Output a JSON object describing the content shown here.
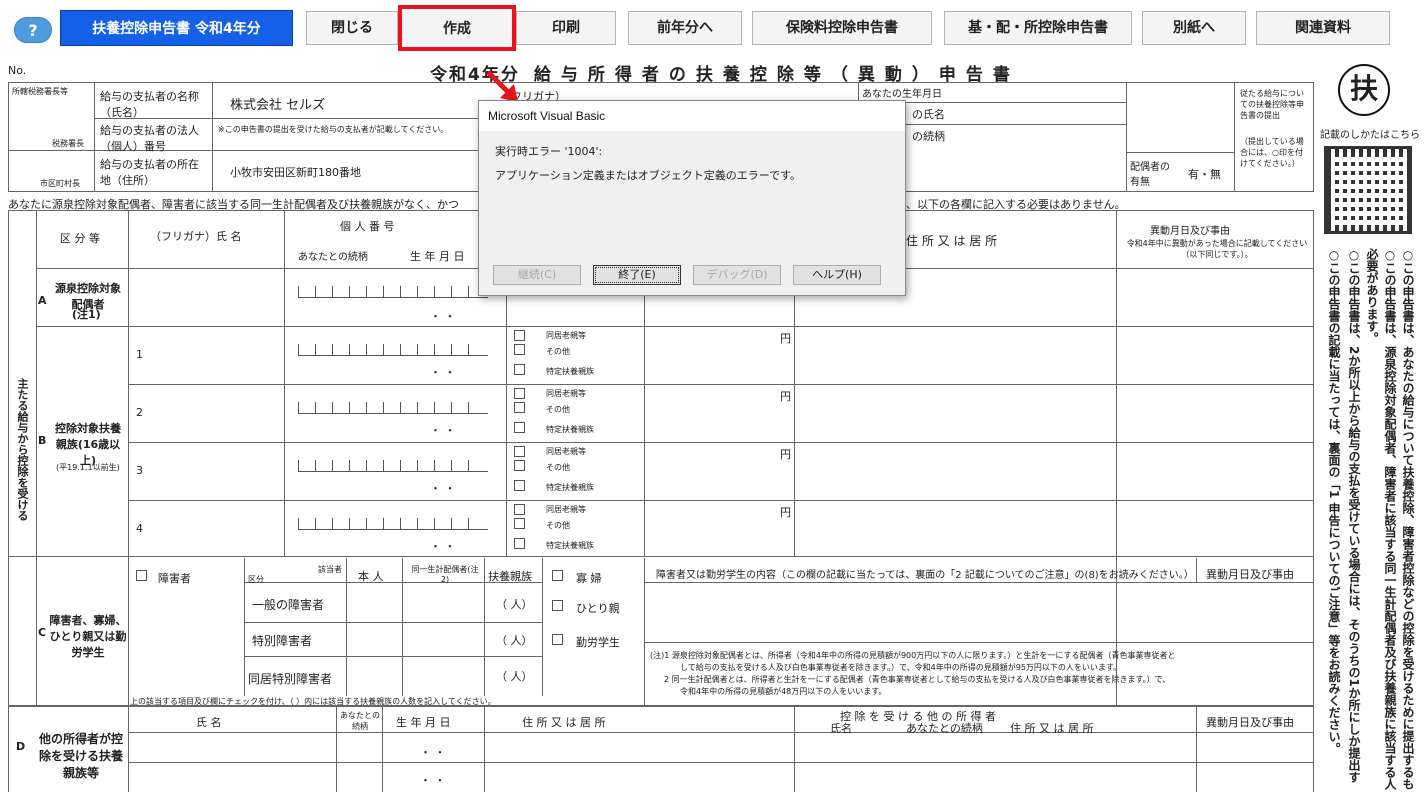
{
  "toolbar": {
    "help": "?",
    "title": "扶養控除申告書 令和4年分",
    "buttons": [
      "閉じる",
      "作成",
      "印刷",
      "前年分へ",
      "保険料控除申告書",
      "基・配・所控除申告書",
      "別紙へ",
      "関連資料"
    ],
    "active_button": "作成",
    "active_color": "#e8141b",
    "title_color": "#1560e8"
  },
  "form": {
    "no_label": "No.",
    "title_year": "令和4年分",
    "title_main": "給与所得者の扶養控除等（異動）申告書",
    "header": {
      "tax_office": "所轄税務署長等",
      "tax_office_suffix": "税務署長",
      "city": "市区町村長",
      "payer_name_label": "給与の支払者の名称（氏名）",
      "payer_name_value": "株式会社 セルズ",
      "payer_number_label": "給与の支払者の法人（個人）番号",
      "payer_number_note": "※この申告書の提出を受けた給与の支払者が記載してください。",
      "payer_address_label": "給与の支払者の所在地（住所）",
      "payer_address_value": "小牧市安田区新町180番地",
      "furigana": "（フリガナ）",
      "birthdate": "あなたの生年月日",
      "householder_name": "の氏名",
      "relation": "の続柄",
      "main_income_note": "従たる給与についての扶養控除等申告書の提出",
      "submit_note": "（提出している場合には、○印を付けてください。）",
      "spouse": "配偶者の有無",
      "spouse_options": "有・無"
    },
    "notice": "あなたに源泉控除対象配偶者、障害者に該当する同一生計配偶者及び扶養親族がなく、かつ",
    "notice_tail": "、以下の各欄に記入する必要はありません。",
    "columns": {
      "category": "区 分 等",
      "name_header": "（フリガナ）氏 名",
      "personal_number": "個 人 番 号",
      "relation": "あなたとの続柄",
      "birthdate": "生 年 月 日",
      "address": "住 所 又 は 居 所",
      "change": "異動月日及び事由",
      "change_note": "令和4年中に異動があった場合に記載してください（以下同じです。）。"
    },
    "side_main": "主たる給与から控除を受ける",
    "row_a": {
      "letter": "A",
      "label": "源泉控除対象配偶者",
      "note": "(注1)"
    },
    "row_b": {
      "letter": "B",
      "label": "控除対象扶養親族(16歳以上)",
      "note": "(平19.1.1以前生)",
      "numbers": [
        "1",
        "2",
        "3",
        "4"
      ]
    },
    "b_options": [
      "同居老親等",
      "その他",
      "特定扶養親族"
    ],
    "yen": "円",
    "date_dots": "・ ・",
    "row_c": {
      "letter": "C",
      "label": "障害者、寡婦、ひとり親又は勤労学生",
      "disabled": "障害者",
      "col_head": "該当者",
      "col_kubun": "区分",
      "col_self": "本 人",
      "col_same": "同一生計配偶者(注2)",
      "col_dep": "扶養親族",
      "kinds": [
        "一般の障害者",
        "特別障害者",
        "同居特別障害者"
      ],
      "persons": "（ 人）",
      "widow": "寡 婦",
      "single": "ひとり親",
      "student": "勤労学生",
      "content": "障害者又は勤労学生の内容（この欄の記載に当たっては、裏面の「2 記載についてのご注意」の(8)をお読みください。）",
      "change": "異動月日及び事由",
      "footnote": "上の該当する項目及び欄にチェックを付け、（ ）内には該当する扶養親族の人数を記入してください。",
      "note1": "(注)1 源泉控除対象配偶者とは、所得者（令和4年中の所得の見積額が900万円以下の人に限ります。）と生計を一にする配偶者（青色事業専従者と",
      "note1b": "して給与の支払を受ける人及び白色事業専従者を除きます。）で、令和4年中の所得の見積額が95万円以下の人をいいます。",
      "note2": "2 同一生計配偶者とは、所得者と生計を一にする配偶者（青色事業専従者として給与の支払を受ける人及び白色事業専従者を除きます。）で、",
      "note2b": "令和4年中の所得の見積額が48万円以下の人をいいます。"
    },
    "row_d": {
      "letter": "D",
      "label": "他の所得者が控除を受ける扶養親族等",
      "name": "氏 名",
      "relation": "あなたとの続柄",
      "birth": "生 年 月 日",
      "address": "住 所 又 は 居 所",
      "other": "控 除 を 受 け る 他 の 所 得 者",
      "other_name": "氏名",
      "other_rel": "あなたとの続柄",
      "other_addr": "住 所 又 は 居 所",
      "change": "異動月日及び事由"
    }
  },
  "right_panel": {
    "fu": "扶",
    "howto": "記載のしかたはこちら",
    "lines": [
      "○この申告書は、あなたの給与について扶養控除、障害者控除などの控除を受けるために提出するも",
      "○この申告書は、源泉控除対象配偶者、障害者に該当する同一生計配偶者及び扶養親族に該当する人",
      "必要があります。",
      "○この申告書は、2か所以上から給与の支払を受けている場合には、そのうちの1か所にしか提出す",
      "○この申告書の記載に当たっては、裏面の「1 申告についてのご注意」等をお読みください。"
    ]
  },
  "dialog": {
    "title": "Microsoft Visual Basic",
    "error": "実行時エラー '1004':",
    "message": "アプリケーション定義またはオブジェクト定義のエラーです。",
    "buttons": [
      "継続(C)",
      "終了(E)",
      "デバッグ(D)",
      "ヘルプ(H)"
    ]
  }
}
